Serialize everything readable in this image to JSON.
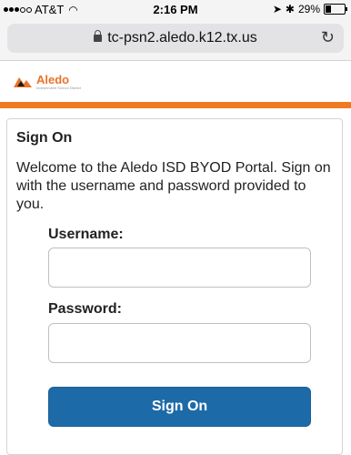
{
  "status_bar": {
    "carrier": "AT&T",
    "time": "2:16 PM",
    "battery": "29%",
    "battery_level": 0.29
  },
  "browser": {
    "url": "tc-psn2.aledo.k12.tx.us"
  },
  "header": {
    "logo_text": "Aledo",
    "logo_subtext": "Independent School District",
    "accent_color": "#f07a22"
  },
  "form": {
    "title": "Sign On",
    "welcome": "Welcome to the Aledo ISD BYOD Portal. Sign on with the username and password provided to you.",
    "username_label": "Username:",
    "username_value": "",
    "password_label": "Password:",
    "password_value": "",
    "submit_label": "Sign On",
    "button_color": "#1d6aa8"
  }
}
